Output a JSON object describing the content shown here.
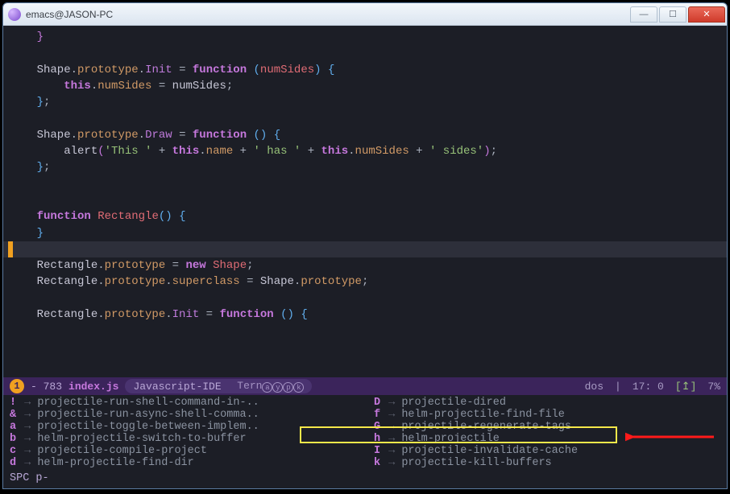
{
  "window": {
    "title": "emacs@JASON-PC"
  },
  "code": {
    "l1": "    }",
    "l3a": "    Shape",
    "l3b": "prototype",
    "l3c": "Init",
    "l3d": "function",
    "l3e": "numSides",
    "l4a": "        ",
    "l4b": "this",
    "l4c": "numSides",
    "l4d": "numSides",
    "l5": "    };",
    "l6a": "    Shape",
    "l6b": "prototype",
    "l6c": "Draw",
    "l6d": "function",
    "l7a": "        alert",
    "l7b": "'This '",
    "l7c": "this",
    "l7d": "name",
    "l7e": "' has '",
    "l7f": "this",
    "l7g": "numSides",
    "l7h": "' sides'",
    "l8": "    };",
    "l9a": "    ",
    "l9b": "function",
    "l9c": "Rectangle",
    "l10": "    }",
    "l11a": "    Rectangle",
    "l11b": "prototype",
    "l11c": "new",
    "l11d": "Shape",
    "l12a": "    Rectangle",
    "l12b": "prototype",
    "l12c": "superclass",
    "l12d": "Shape",
    "l12e": "prototype",
    "l13a": "    Rectangle",
    "l13b": "prototype",
    "l13c": "Init",
    "l13d": "function"
  },
  "modeline": {
    "badge": "1",
    "line": "- 783",
    "file": "index.js",
    "mode": "Javascript-IDE",
    "tern": "Tern",
    "enc": "dos",
    "pos": "17: 0",
    "vc": "↥",
    "pct": "7%"
  },
  "whichkey": {
    "left": [
      {
        "k": "!",
        "c": "projectile-run-shell-command-in-.."
      },
      {
        "k": "&",
        "c": "projectile-run-async-shell-comma.."
      },
      {
        "k": "a",
        "c": "projectile-toggle-between-implem.."
      },
      {
        "k": "b",
        "c": "helm-projectile-switch-to-buffer"
      },
      {
        "k": "c",
        "c": "projectile-compile-project"
      },
      {
        "k": "d",
        "c": "helm-projectile-find-dir"
      }
    ],
    "right": [
      {
        "k": "D",
        "c": "projectile-dired"
      },
      {
        "k": "f",
        "c": "helm-projectile-find-file"
      },
      {
        "k": "G",
        "c": "projectile-regenerate-tags"
      },
      {
        "k": "h",
        "c": "helm-projectile"
      },
      {
        "k": "I",
        "c": "projectile-invalidate-cache"
      },
      {
        "k": "k",
        "c": "projectile-kill-buffers"
      }
    ]
  },
  "minibuf": "SPC p-"
}
